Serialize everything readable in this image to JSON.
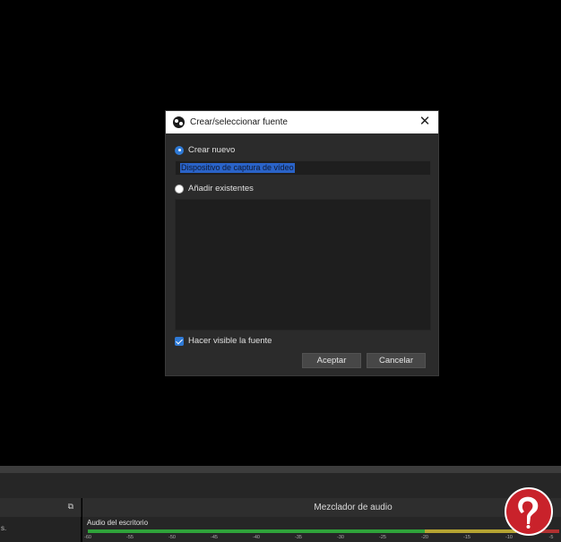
{
  "dialog": {
    "title": "Crear/seleccionar fuente",
    "create_new_label": "Crear nuevo",
    "name_value": "Dispositivo de captura de vídeo",
    "add_existing_label": "Añadir existentes",
    "visible_label": "Hacer visible la fuente",
    "accept_label": "Aceptar",
    "cancel_label": "Cancelar"
  },
  "mixer": {
    "title": "Mezclador de audio",
    "channel_name": "Audio del escritorio",
    "ticks": [
      "-60",
      "-55",
      "-50",
      "-45",
      "-40",
      "-35",
      "-30",
      "-25",
      "-20",
      "-15",
      "-10",
      "-5"
    ]
  },
  "left_panel": {
    "mark": "s."
  },
  "icons": {
    "app": "obs-logo-icon",
    "close": "close-icon",
    "float": "dock-float-icon",
    "watermark": "brand-logo-icon"
  }
}
